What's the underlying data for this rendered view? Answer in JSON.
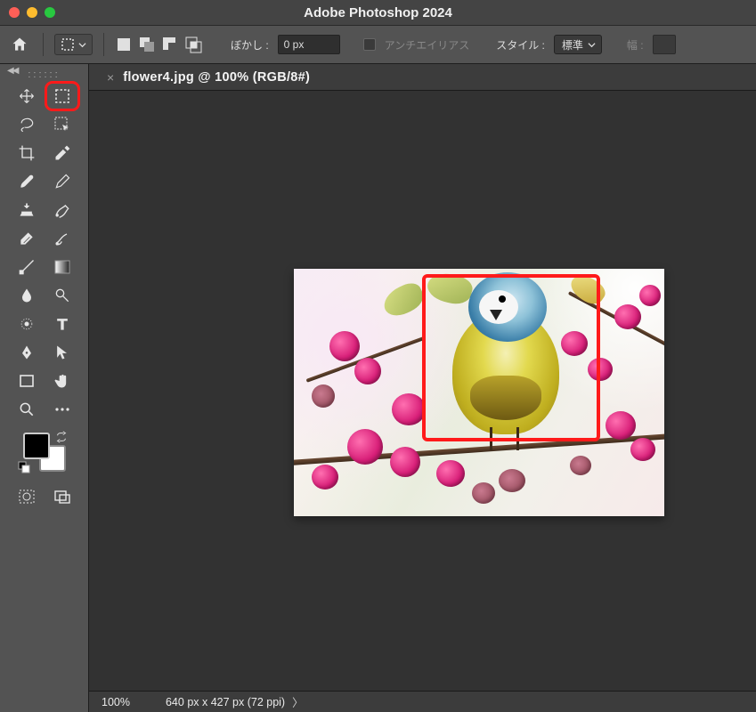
{
  "window": {
    "title": "Adobe Photoshop 2024",
    "traffic": {
      "close": "#ff5f57",
      "min": "#febc2e",
      "max": "#28c840"
    }
  },
  "optionbar": {
    "feather_label": "ぼかし :",
    "feather_value": "0 px",
    "antialias_label": "アンチエイリアス",
    "style_label": "スタイル :",
    "style_value": "標準",
    "width_label": "幅 :"
  },
  "tab": {
    "label": "flower4.jpg @ 100% (RGB/8#)"
  },
  "status": {
    "zoom": "100%",
    "info": "640 px x 427 px (72 ppi)"
  },
  "tools": {
    "left": [
      "move-tool",
      "lasso-tool",
      "crop-tool",
      "brush-tool",
      "clone-tool",
      "history-brush-tool",
      "eraser-tool",
      "blur-tool",
      "smudge-tool",
      "pen-tool",
      "rectangle-shape-tool",
      "zoom-tool"
    ],
    "right": [
      "marquee-tool",
      "quick-select-tool",
      "eyedropper-tool",
      "pencil-tool",
      "healing-tool",
      "art-history-tool",
      "gradient-tool",
      "paint-bucket-tool",
      "type-tool",
      "direct-select-tool",
      "hand-tool",
      "more-tools"
    ]
  }
}
